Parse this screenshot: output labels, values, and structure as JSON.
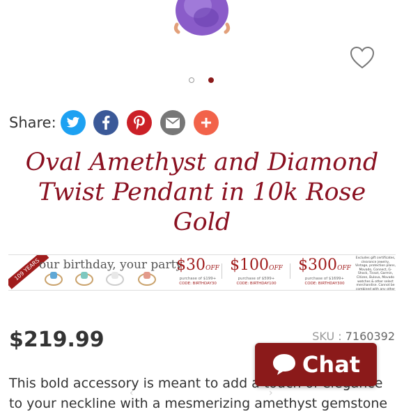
{
  "product_image": {
    "description_icon": "gem-pendant-image"
  },
  "favorite": {
    "icon": "heart-icon"
  },
  "carousel": {
    "count": 2,
    "active_index": 1
  },
  "share": {
    "label": "Share:",
    "buttons": [
      {
        "name": "twitter",
        "icon": "twitter-icon",
        "color": "#1da1f2"
      },
      {
        "name": "facebook",
        "icon": "facebook-icon",
        "color": "#3b5998"
      },
      {
        "name": "pinterest",
        "icon": "pinterest-icon",
        "color": "#cb2027"
      },
      {
        "name": "email",
        "icon": "email-icon",
        "color": "#777777"
      },
      {
        "name": "more",
        "icon": "plus-icon",
        "color": "#f2634a"
      }
    ]
  },
  "product": {
    "title": "Oval Amethyst and Diamond Twist Pendant in 10k Rose Gold",
    "price": "$219.99",
    "sku_label": "SKU :",
    "sku_value": "7160392",
    "description": "This bold accessory is meant to add a touch of elegance to your neckline with a mesmerizing amethyst gemstone"
  },
  "promo_banner": {
    "ribbon": "109 YEARS",
    "headline": "our birthday, your party",
    "offers": [
      {
        "amount": "$30",
        "off": "OFF",
        "min": "purchase of $199+",
        "code": "CODE: BIRTHDAY30"
      },
      {
        "amount": "$100",
        "off": "OFF",
        "min": "purchase of $599+",
        "code": "CODE: BIRTHDAY100"
      },
      {
        "amount": "$300",
        "off": "OFF",
        "min": "purchase of $1699+",
        "code": "CODE: BIRTHDAY300"
      }
    ],
    "fine_print": "Excludes gift certificates, clearance jewelry, Vintage, protection plans, Movado, Connect, G-Shock, Tissot, Garmin, Citizen, Bulova, Movado watches & other select merchandise. Cannot be combined with any other sale, discount or coupons."
  },
  "chat": {
    "label": "Chat",
    "icon": "chat-bubble-icon"
  },
  "accent_color": "#8b1a1a"
}
